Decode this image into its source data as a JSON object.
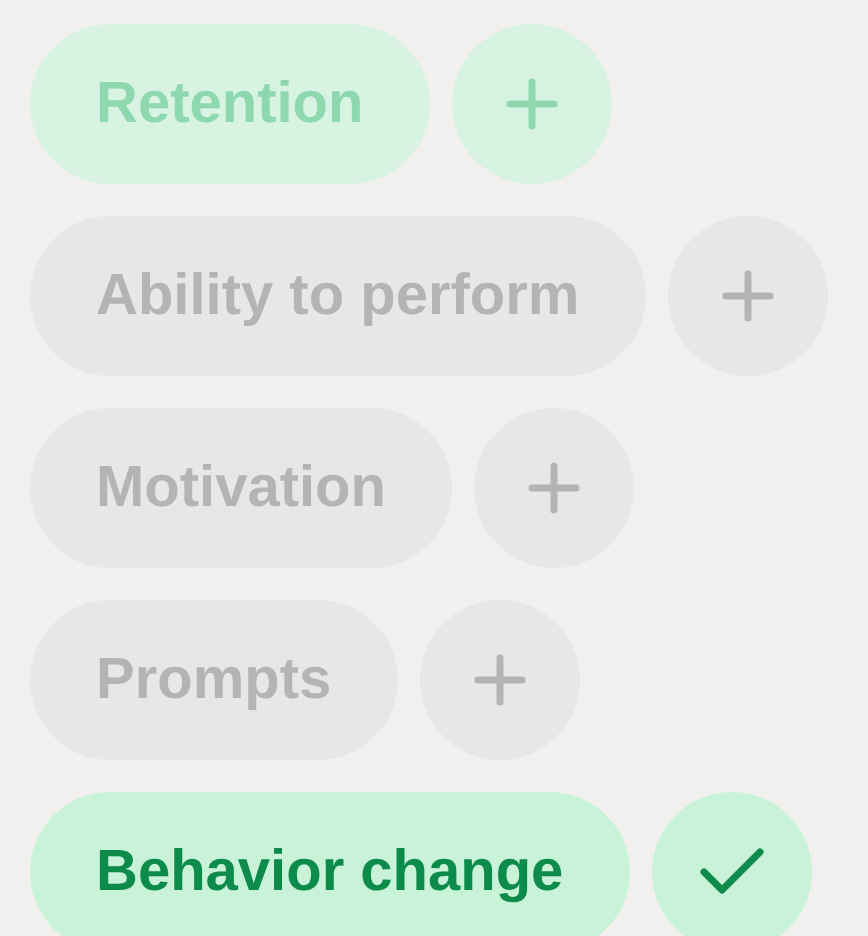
{
  "chips": [
    {
      "label": "Retention",
      "kind": "suggested"
    },
    {
      "label": "Ability to perform",
      "kind": "plain"
    },
    {
      "label": "Motivation",
      "kind": "plain"
    },
    {
      "label": "Prompts",
      "kind": "plain"
    },
    {
      "label": "Behavior change",
      "kind": "chosen"
    }
  ]
}
